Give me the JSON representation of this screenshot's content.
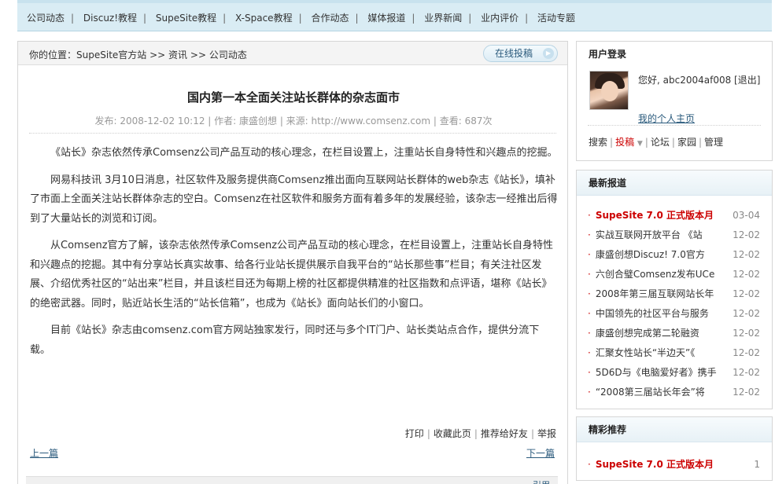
{
  "nav": {
    "items": [
      "公司动态",
      "Discuz!教程",
      "SupeSite教程",
      "X-Space教程",
      "合作动态",
      "媒体报道",
      "业界新闻",
      "业内评价",
      "活动专题"
    ]
  },
  "breadcrumb": {
    "prefix": "你的位置：",
    "site": "SupeSite官方站",
    "sep1": ">>",
    "section": "资讯",
    "sep2": ">>",
    "category": "公司动态"
  },
  "submit_button": "在线投稿",
  "article": {
    "title": "国内第一本全面关注站长群体的杂志面市",
    "meta": "发布: 2008-12-02 10:12 |  作者: 康盛创想 |  来源: http://www.comsenz.com | 查看: 687次",
    "paragraphs": [
      "《站长》杂志依然传承Comsenz公司产品互动的核心理念，在栏目设置上，注重站长自身特性和兴趣点的挖掘。",
      "网易科技讯  3月10日消息，社区软件及服务提供商Comsenz推出面向互联网站长群体的web杂志《站长》，填补了市面上全面关注站长群体杂志的空白。Comsenz在社区软件和服务方面有着多年的发展经验，该杂志一经推出后得到了大量站长的浏览和订阅。",
      "从Comsenz官方了解，该杂志依然传承Comsenz公司产品互动的核心理念，在栏目设置上，注重站长自身特性和兴趣点的挖掘。其中有分享站长真实故事、给各行业站长提供展示自我平台的“站长那些事”栏目；有关注社区发展、介绍优秀社区的“站出来”栏目，并且该栏目还为每期上榜的社区都提供精准的社区指数和点评语，堪称《站长》的绝密武器。同时，贴近站长生活的“站长信箱”，也成为《站长》面向站长们的小窗口。",
      "目前《站长》杂志由comsenz.com官方网站独家发行，同时还与多个IT门户、站长类站点合作，提供分流下载。"
    ]
  },
  "tools": [
    "打印",
    "收藏此页",
    "推荐给好友",
    "举报"
  ],
  "pager": {
    "prev": "上一篇",
    "next": "下一篇"
  },
  "bottom_strip_right": "引用",
  "login": {
    "title": "用户登录",
    "greeting": "您好, abc2004af008 [退出]",
    "my_home": "我的个人主页",
    "links": [
      "搜索",
      "投稿",
      "论坛",
      "家园",
      "管理"
    ]
  },
  "latest": {
    "title": "最新报道",
    "items": [
      {
        "title": "SupeSite 7.0 正式版本月",
        "date": "03-04",
        "highlight": true
      },
      {
        "title": "实战互联网开放平台 《站",
        "date": "12-02"
      },
      {
        "title": "康盛创想Discuz! 7.0官方",
        "date": "12-02"
      },
      {
        "title": "六创合璧Comsenz发布UCe",
        "date": "12-02"
      },
      {
        "title": "2008年第三届互联网站长年",
        "date": "12-02"
      },
      {
        "title": "中国领先的社区平台与服务",
        "date": "12-02"
      },
      {
        "title": "康盛创想完成第二轮融资",
        "date": "12-02"
      },
      {
        "title": "汇聚女性站长“半边天”《",
        "date": "12-02"
      },
      {
        "title": "5D6D与《电脑爱好者》携手",
        "date": "12-02"
      },
      {
        "title": "“2008第三届站长年会”将",
        "date": "12-02"
      }
    ]
  },
  "featured": {
    "title": "精彩推荐",
    "items": [
      {
        "title": "SupeSite 7.0 正式版本月",
        "date": "1",
        "highlight": true
      }
    ]
  },
  "colors": {
    "accent_red": "#cc0000",
    "link_blue": "#2a5a7c",
    "nav_bg": "#d9ecf4"
  }
}
